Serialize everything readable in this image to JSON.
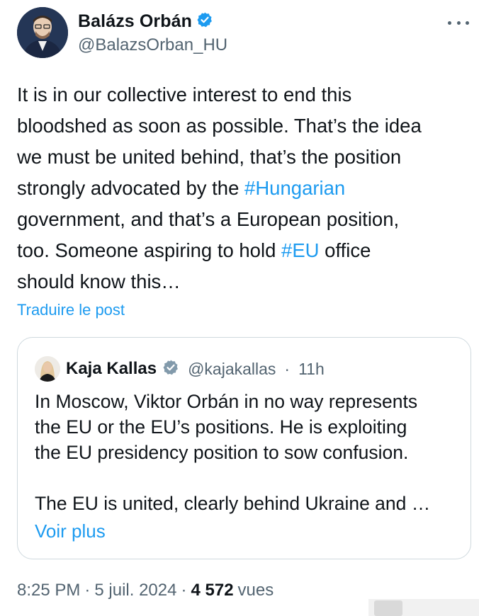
{
  "author": {
    "name": "Balázs Orbán",
    "handle": "@BalazsOrban_HU",
    "verified": true
  },
  "post": {
    "line1": "It is in our collective interest to end this",
    "line2": "bloodshed as soon as possible. That’s the idea",
    "line3": "we must be united behind, that’s the position",
    "line4_prefix": "strongly advocated by the ",
    "hashtag_hungarian": "#Hungarian",
    "line5": "government, and that’s a European position,",
    "line6_prefix": "too. Someone aspiring to hold ",
    "hashtag_eu": "#EU",
    "line6_suffix": " office",
    "line7": "should know this…",
    "translate_label": "Traduire le post"
  },
  "quote": {
    "name": "Kaja Kallas",
    "handle": "@kajakallas",
    "separator": "·",
    "time": "11h",
    "line1": "In Moscow, Viktor Orbán in no way represents",
    "line2": "the EU or the EU’s positions. He is exploiting",
    "line3": "the EU presidency position to sow confusion.",
    "line4": "The EU is united, clearly behind Ukraine and …",
    "see_more": "Voir plus"
  },
  "meta": {
    "time": "8:25 PM",
    "separator": "·",
    "date": "5 juil. 2024",
    "views_count": "4 572",
    "views_label": "vues"
  },
  "colors": {
    "accent": "#1d9bf0",
    "verified_badge": "#1d9bf0",
    "verified_badge_gray": "#829aab",
    "secondary_text": "#536471"
  },
  "icons": [
    "more-icon",
    "verified-badge-icon",
    "gray-verified-badge-icon"
  ]
}
